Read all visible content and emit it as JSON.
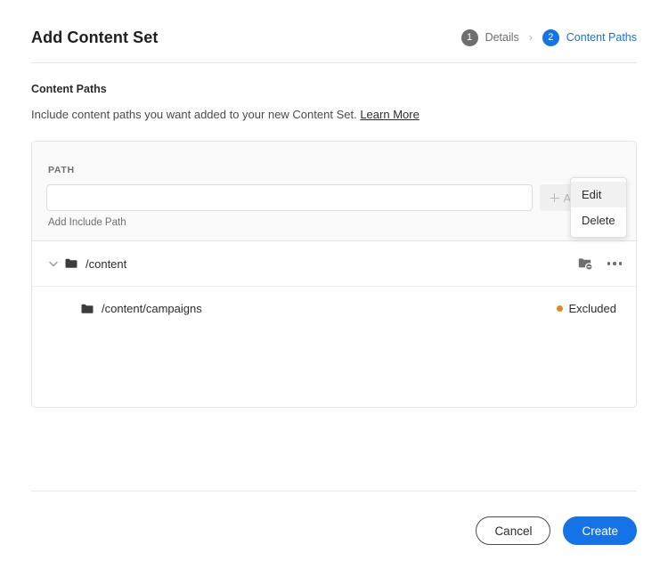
{
  "header": {
    "title": "Add Content Set",
    "stepper": {
      "separator": "›",
      "steps": [
        {
          "number": "1",
          "label": "Details",
          "state": "done"
        },
        {
          "number": "2",
          "label": "Content Paths",
          "state": "active"
        }
      ]
    }
  },
  "section": {
    "title": "Content Paths",
    "description": "Include content paths you want added to your new Content Set.",
    "link_label": "Learn More"
  },
  "path_panel": {
    "label": "PATH",
    "input_value": "",
    "input_placeholder": "",
    "add_button_label": "Add Path",
    "helper_text": "Add Include Path"
  },
  "tree": {
    "rows": [
      {
        "label": "/content",
        "expanded": true,
        "indent": 0,
        "status": "",
        "exclude_icon": "folder-remove-icon",
        "more_icon": "more-options-icon"
      },
      {
        "label": "/content/campaigns",
        "expanded": false,
        "indent": 1,
        "status": "Excluded",
        "status_color": "#e68619"
      }
    ]
  },
  "popup_menu": {
    "items": [
      {
        "label": "Edit",
        "hover": true
      },
      {
        "label": "Delete",
        "hover": false
      }
    ]
  },
  "footer": {
    "cancel_label": "Cancel",
    "create_label": "Create"
  },
  "colors": {
    "accent_blue": "#1473e6",
    "status_orange": "#e68619",
    "step_done_gray": "#6e6e6e"
  }
}
